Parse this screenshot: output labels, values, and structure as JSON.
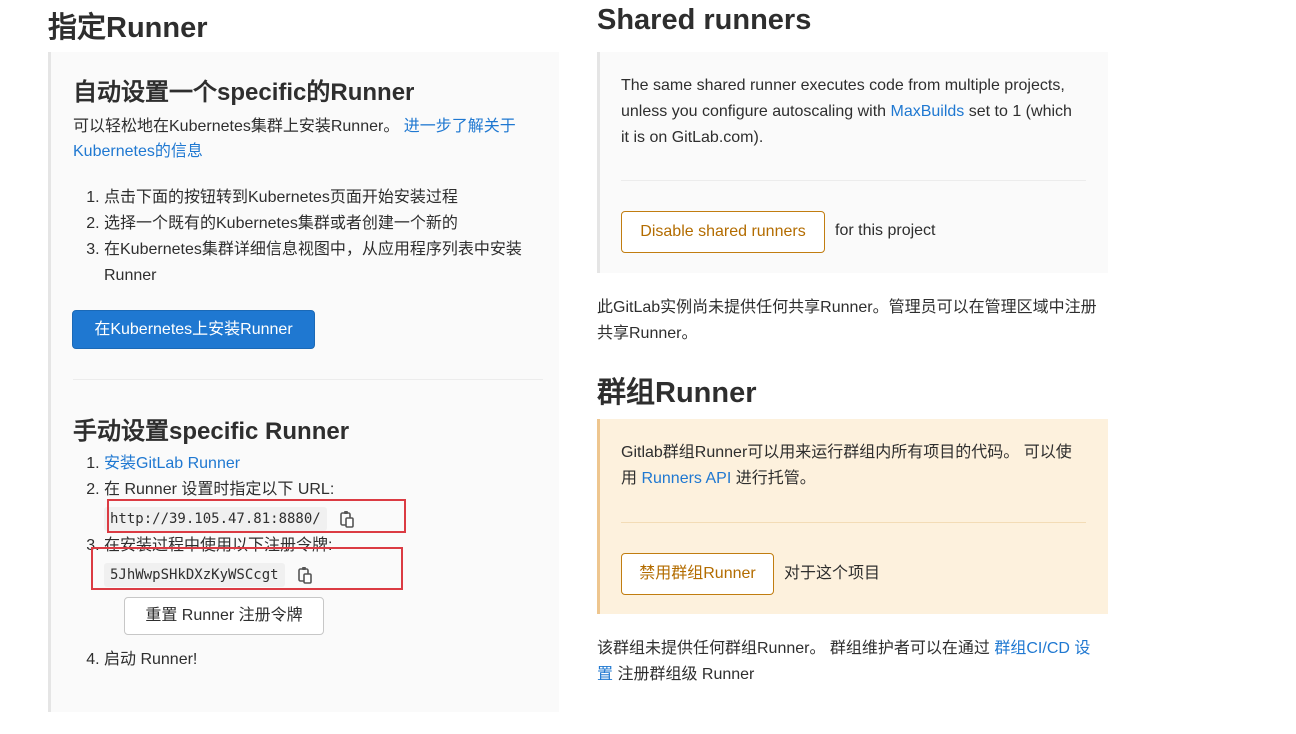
{
  "left": {
    "title": "指定Runner",
    "auto": {
      "heading": "自动设置一个specific的Runner",
      "intro": "可以轻松地在Kubernetes集群上安装Runner。",
      "intro_link": "进一步了解关于Kubernetes的信息",
      "steps": [
        "点击下面的按钮转到Kubernetes页面开始安装过程",
        "选择一个既有的Kubernetes集群或者创建一个新的",
        "在Kubernetes集群详细信息视图中，从应用程序列表中安装Runner"
      ],
      "install_button": "在Kubernetes上安装Runner"
    },
    "manual": {
      "heading": "手动设置specific Runner",
      "step1_link": "安装GitLab Runner",
      "step2_text": "在 Runner 设置时指定以下 URL:",
      "url": "http://39.105.47.81:8880/",
      "step3_text": "在安装过程中使用以下注册令牌:",
      "token": "5JhWwpSHkDXzKyWSCcgt",
      "reset_button": "重置 Runner 注册令牌",
      "step4_text": "启动 Runner!"
    }
  },
  "shared": {
    "title": "Shared runners",
    "desc_before": "The same shared runner executes code from multiple projects, unless you configure autoscaling with ",
    "desc_link": "MaxBuilds",
    "desc_after": " set to 1 (which it is on GitLab.com).",
    "disable_button": "Disable shared runners",
    "for_project": "for this project",
    "note": "此GitLab实例尚未提供任何共享Runner。管理员可以在管理区域中注册共享Runner。"
  },
  "group": {
    "title": "群组Runner",
    "desc_before": "Gitlab群组Runner可以用来运行群组内所有项目的代码。 可以使用 ",
    "desc_link": "Runners API",
    "desc_after": " 进行托管。",
    "disable_button": "禁用群组Runner",
    "for_project": "对于这个项目",
    "note_before": "该群组未提供任何群组Runner。 群组维护者可以在通过 ",
    "note_link": "群组CI/CD 设置",
    "note_after": " 注册群组级 Runner"
  },
  "icons": {
    "clipboard": "clipboard-icon"
  },
  "colors": {
    "link": "#1f78d1",
    "primary_button": "#1f78d1",
    "warning_border": "#c17d10",
    "highlight_box": "#db3b43"
  }
}
